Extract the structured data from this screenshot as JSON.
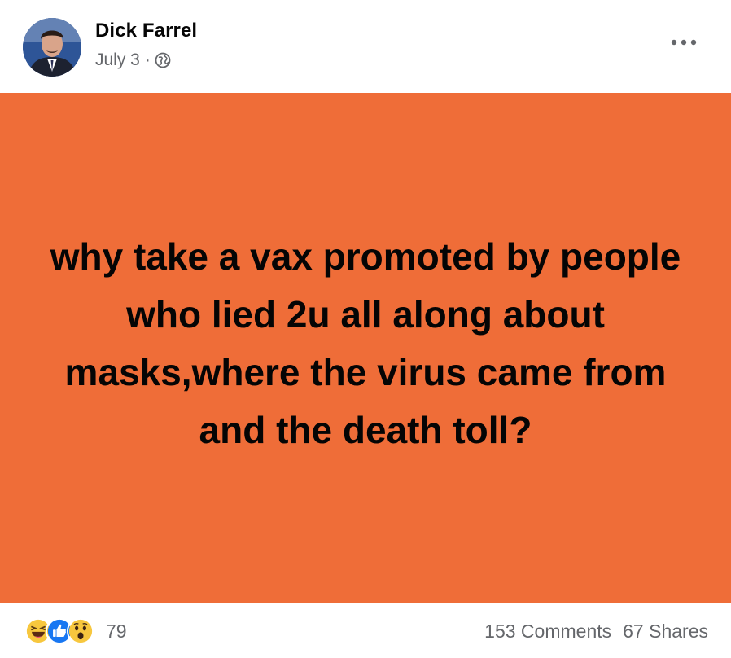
{
  "post": {
    "author": "Dick Farrel",
    "date": "July 3",
    "separator": "·",
    "privacy_icon": "globe-icon",
    "more_icon": "more-horizontal-icon",
    "background_color": "#ef6d38",
    "text": "why take a vax promoted by people who lied 2u all along about masks,where the virus came from and the death toll?"
  },
  "footer": {
    "reaction_icons": [
      "haha-reaction-icon",
      "like-reaction-icon",
      "wow-reaction-icon"
    ],
    "reaction_count": "79",
    "comments": "153 Comments",
    "shares": "67 Shares"
  }
}
